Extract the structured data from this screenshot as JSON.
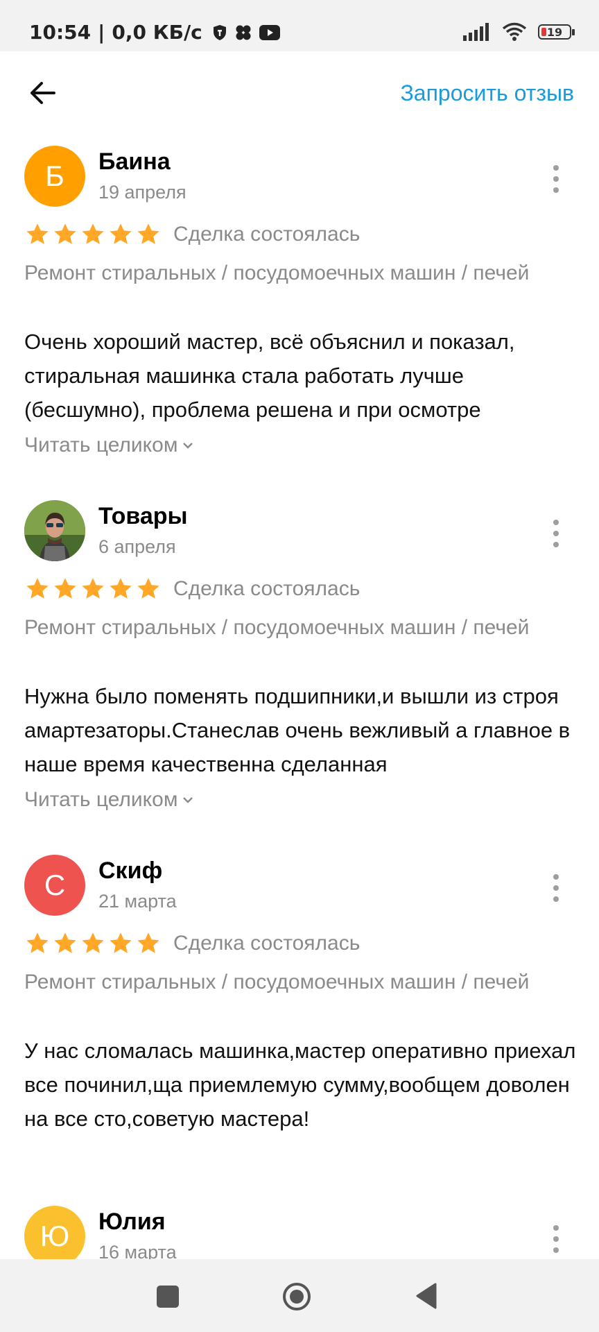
{
  "status_bar": {
    "time": "10:54",
    "network_speed": "0,0 КБ/с",
    "battery_level": "19"
  },
  "header": {
    "request_review_label": "Запросить отзыв"
  },
  "reviews": [
    {
      "avatar_letter": "Б",
      "avatar_color": "#ffa000",
      "name": "Баина",
      "date": "19 апреля",
      "deal_status": "Сделка состоялась",
      "service": "Ремонт стиральных / посудомоечных машин / печей",
      "text": "Очень хороший мастер, всё объяснил и показал, стиральная машинка стала работать лучше (бесшумно), проблема решена и при осмотре",
      "read_more": "Читать целиком"
    },
    {
      "avatar_letter": "",
      "avatar_color": "",
      "name": "Товары",
      "date": "6 апреля",
      "deal_status": "Сделка состоялась",
      "service": "Ремонт стиральных / посудомоечных машин / печей",
      "text": "Нужна было поменять подшипники,и вышли из строя амартезаторы.Станеслав очень вежливый а главное в наше время качественна сделанная",
      "read_more": "Читать целиком"
    },
    {
      "avatar_letter": "С",
      "avatar_color": "#ef5350",
      "name": "Скиф",
      "date": "21 марта",
      "deal_status": "Сделка состоялась",
      "service": "Ремонт стиральных / посудомоечных машин / печей",
      "text": "У нас сломалась машинка,мастер оперативно приехал все починил,ща приемлемую сумму,вообщем доволен на все сто,советую мастера!",
      "read_more": ""
    },
    {
      "avatar_letter": "Ю",
      "avatar_color": "#fbc02d",
      "name": "Юлия",
      "date": "16 марта"
    }
  ],
  "rating": {
    "stars": 5,
    "max": 5,
    "star_color": "#ffa726"
  },
  "colors": {
    "accent": "#1a9bdc",
    "muted": "#8a8a8a"
  }
}
